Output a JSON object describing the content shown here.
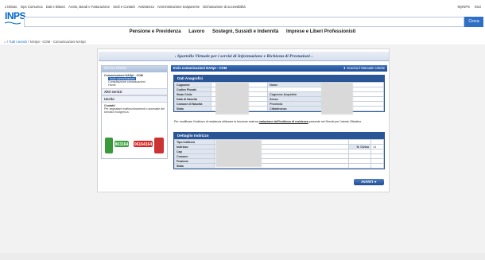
{
  "topbar": {
    "links": [
      "L'Istituto",
      "Inps Comunica",
      "Dati e Bilanci",
      "Avvisi, Bandi e Fatturazione",
      "Sedi e Contatti",
      "Assistenza",
      "Amministrazione trasparente",
      "Dichiarazione di accessibilità"
    ],
    "right_links": [
      "MyINPS",
      "Esci"
    ]
  },
  "logo": "INPS",
  "search": {
    "placeholder": "",
    "button_label": "Cerca"
  },
  "main_nav": [
    "Pensione e Previdenza",
    "Lavoro",
    "Sostegni, Sussidi e Indennità",
    "Imprese e Liberi Professionisti"
  ],
  "breadcrumb": {
    "home": "Tutti i servizi",
    "current": "NASpI - COM - Comunicazioni NASpI"
  },
  "banner": "Sportello Virtuale per i servizi di Informazione e Richiesta di Prestazioni",
  "left": {
    "header": "Servizi Online",
    "section_title": "Comunicazioni NASpI - COM",
    "items": [
      "Invio comunicazioni",
      "Consultazione comunicazioni",
      "Home"
    ],
    "altri_servizi": "Altri servizi",
    "uscita": "Uscita",
    "contatti_title": "Contatti",
    "contatti_text": "Per segnalare malfunzionamenti o anomalie del servizio rivolgersi a:",
    "phone1": "803164",
    "phone2": "06164164"
  },
  "right": {
    "header": "Invio comunicazioni NASpI - COM",
    "scarica": "Scarica il Manuale Utente",
    "anagrafici": {
      "title": "Dati Anagrafici",
      "rows": [
        [
          "Cognome",
          "Nome"
        ],
        [
          "Codice Fiscale",
          ""
        ],
        [
          "Stato Civile",
          "Cognome Acquisito"
        ],
        [
          "Data di Nascita",
          "Sesso"
        ],
        [
          "Comune di Nascita",
          "Provincia"
        ],
        [
          "Stato",
          "Cittadinanza"
        ]
      ]
    },
    "note": "Per modificare l'indirizzo di residenza utilizzare la funzione esterna",
    "note_link": "variazione dell'indirizzo di residenza",
    "note_end": "presente nei Servizi per l'utente Cittadino.",
    "indirizzo": {
      "title": "Dettaglio Indirizzo",
      "rows": [
        "Tipo Indirizzo",
        "Indirizzo",
        "Cap",
        "Comune",
        "Frazione",
        "Stato"
      ],
      "civico_label": "N. Civico",
      "civico_value": "14"
    },
    "avanti": "AVANTI"
  }
}
